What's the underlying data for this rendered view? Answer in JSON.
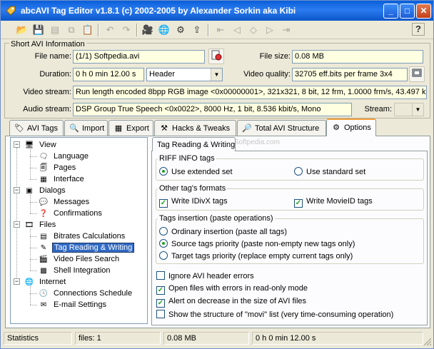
{
  "window": {
    "title": "abcAVI Tag Editor v1.8.1 (c) 2002-2005 by Alexander Sorkin aka Kibi",
    "min_glyph": "_",
    "max_glyph": "□",
    "close_glyph": "✕"
  },
  "toolbar": {
    "open": "📂",
    "save": "💾",
    "save_all": "▤",
    "copy": "⧉",
    "paste": "📋",
    "undo": "↶",
    "redo": "↷",
    "video": "🎥",
    "web": "🌐",
    "settings": "⚙",
    "export": "⇪",
    "first": "⇤",
    "prev": "◁",
    "diamond": "◇",
    "next": "▷",
    "last": "⇥",
    "help": "?"
  },
  "short_info": {
    "legend": "Short AVI Information",
    "file_name_label": "File name:",
    "file_name": "(1/1) Softpedia.avi",
    "file_size_label": "File size:",
    "file_size": "0.08 MB",
    "duration_label": "Duration:",
    "duration": "0 h 0 min 12.00 s",
    "duration_mode": "Header",
    "video_quality_label": "Video quality:",
    "video_quality": "32705 eff.bits per frame 3x4",
    "video_stream_label": "Video stream:",
    "video_stream": "Run length encoded 8bpp RGB image <0x00000001>, 321x321, 8 bit, 12 frm, 1.0000 frm/s, 43.497 kbit",
    "audio_stream_label": "Audio stream:",
    "audio_stream": "DSP Group True Speech <0x0022>, 8000 Hz, 1 bit, 8.536 kbit/s, Mono",
    "stream_label": "Stream:"
  },
  "tabs": [
    {
      "label": "AVI Tags",
      "icon": "🏷"
    },
    {
      "label": "Import",
      "icon": "🔍"
    },
    {
      "label": "Export",
      "icon": "▦"
    },
    {
      "label": "Hacks & Tweaks",
      "icon": "⚒"
    },
    {
      "label": "Total AVI Structure",
      "icon": "🔎"
    },
    {
      "label": "Options",
      "icon": "⚙"
    }
  ],
  "tree": {
    "view": "View",
    "language": "Language",
    "pages": "Pages",
    "interface": "Interface",
    "dialogs": "Dialogs",
    "messages": "Messages",
    "confirmations": "Confirmations",
    "files": "Files",
    "bitrates": "Bitrates Calculations",
    "tag_rw": "Tag Reading & Writing",
    "video_search": "Video Files Search",
    "shell": "Shell Integration",
    "internet": "Internet",
    "schedule": "Connections Schedule",
    "email": "E-mail Settings",
    "minus": "−"
  },
  "options": {
    "tab_label": "Tag Reading & Writing",
    "watermark": "Softpedia.com",
    "riff_legend": "RIFF INFO tags",
    "riff_extended": "Use extended set",
    "riff_standard": "Use standard set",
    "formats_legend": "Other tag's formats",
    "write_idivx": "Write IDivX tags",
    "write_movieid": "Write MovieID tags",
    "insertion_legend": "Tags insertion (paste operations)",
    "ins_ordinary": "Ordinary insertion (paste all tags)",
    "ins_source": "Source tags priority (paste non-empty new tags only)",
    "ins_target": "Target tags priority (replace empty current tags only)",
    "ignore_header": "Ignore AVI header errors",
    "open_readonly": "Open files with errors in read-only mode",
    "alert_decrease": "Alert on decrease in the size of AVI files",
    "show_movi": "Show the structure of \"movi\" list (very time-consuming operation)",
    "check_glyph": "✓"
  },
  "status": {
    "label": "Statistics",
    "files": "files: 1",
    "size": "0.08 MB",
    "duration": "0 h 0 min 12.00 s"
  }
}
